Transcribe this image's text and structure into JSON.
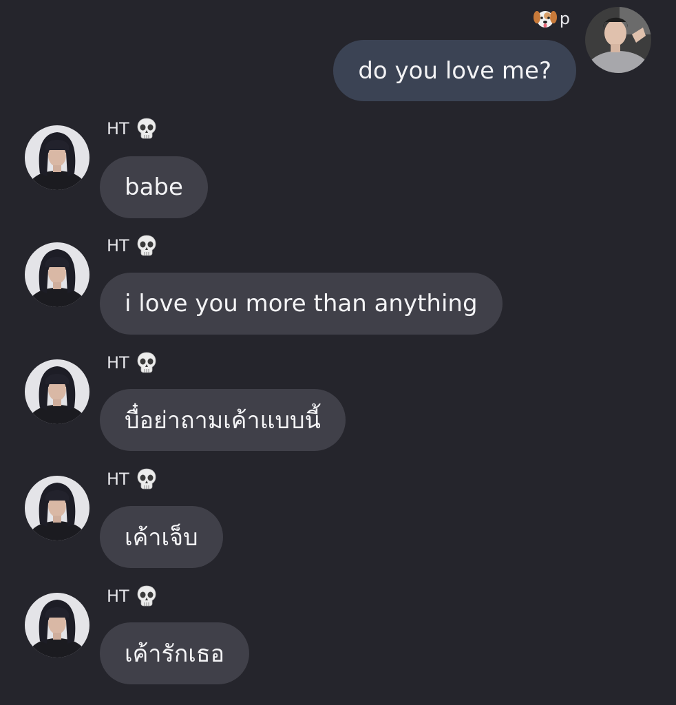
{
  "outgoing": {
    "sender_label": "p",
    "sender_icon": "dog-face-icon",
    "text": "do you love me?",
    "bubble_color": "#3b4354"
  },
  "incoming": [
    {
      "sender": "HT",
      "sender_icon": "skull-icon",
      "text": "babe"
    },
    {
      "sender": "HT",
      "sender_icon": "skull-icon",
      "text": "i love you more than anything"
    },
    {
      "sender": "HT",
      "sender_icon": "skull-icon",
      "text": "บื๋อย่าถามเค้าแบบนี้"
    },
    {
      "sender": "HT",
      "sender_icon": "skull-icon",
      "text": "เค้าเจ็บ"
    },
    {
      "sender": "HT",
      "sender_icon": "skull-icon",
      "text": "เค้ารักเธอ"
    }
  ],
  "colors": {
    "background": "#25252c",
    "incoming_bubble": "#404049",
    "text": "#f3f3f5"
  }
}
